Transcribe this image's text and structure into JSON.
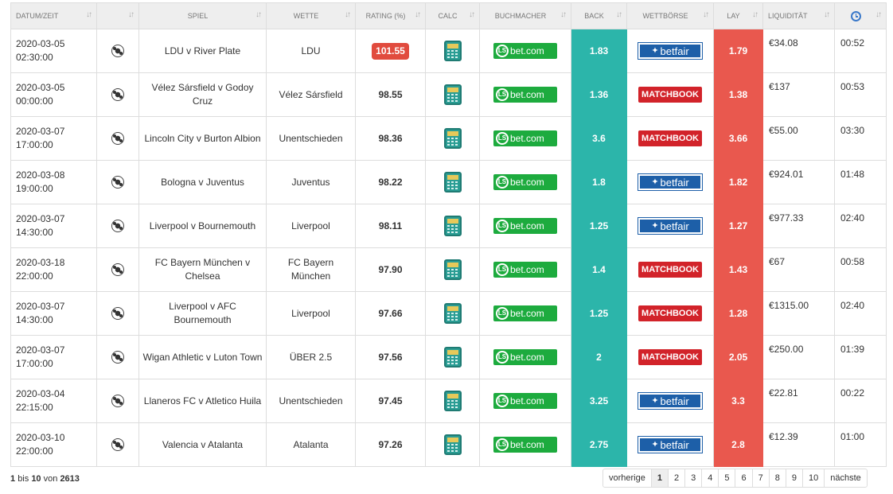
{
  "header": [
    "Datum/Zeit",
    "",
    "Spiel",
    "Wette",
    "Rating (%)",
    "Calc",
    "Buchmacher",
    "Back",
    "Wettbörse",
    "Lay",
    "Liquidität",
    ""
  ],
  "sort_icon": "sort-arrows-icon",
  "rows": [
    {
      "date": "2020-03-05",
      "time": "02:30:00",
      "match": "LDU v River Plate",
      "bet": "LDU",
      "rating": "101.55",
      "hot": true,
      "back": "1.83",
      "exchange": "betfair",
      "lay": "1.79",
      "liquidity": "€34.08",
      "remaining": "00:52"
    },
    {
      "date": "2020-03-05",
      "time": "00:00:00",
      "match": "Vélez Sársfield v Godoy Cruz",
      "bet": "Vélez Sársfield",
      "rating": "98.55",
      "hot": false,
      "back": "1.36",
      "exchange": "matchbook",
      "lay": "1.38",
      "liquidity": "€137",
      "remaining": "00:53"
    },
    {
      "date": "2020-03-07",
      "time": "17:00:00",
      "match": "Lincoln City v Burton Albion",
      "bet": "Unentschieden",
      "rating": "98.36",
      "hot": false,
      "back": "3.6",
      "exchange": "matchbook",
      "lay": "3.66",
      "liquidity": "€55.00",
      "remaining": "03:30"
    },
    {
      "date": "2020-03-08",
      "time": "19:00:00",
      "match": "Bologna v Juventus",
      "bet": "Juventus",
      "rating": "98.22",
      "hot": false,
      "back": "1.8",
      "exchange": "betfair",
      "lay": "1.82",
      "liquidity": "€924.01",
      "remaining": "01:48"
    },
    {
      "date": "2020-03-07",
      "time": "14:30:00",
      "match": "Liverpool v Bournemouth",
      "bet": "Liverpool",
      "rating": "98.11",
      "hot": false,
      "back": "1.25",
      "exchange": "betfair",
      "lay": "1.27",
      "liquidity": "€977.33",
      "remaining": "02:40"
    },
    {
      "date": "2020-03-18",
      "time": "22:00:00",
      "match": "FC Bayern München v Chelsea",
      "bet": "FC Bayern München",
      "rating": "97.90",
      "hot": false,
      "back": "1.4",
      "exchange": "matchbook",
      "lay": "1.43",
      "liquidity": "€67",
      "remaining": "00:58"
    },
    {
      "date": "2020-03-07",
      "time": "14:30:00",
      "match": "Liverpool v AFC Bournemouth",
      "bet": "Liverpool",
      "rating": "97.66",
      "hot": false,
      "back": "1.25",
      "exchange": "matchbook",
      "lay": "1.28",
      "liquidity": "€1315.00",
      "remaining": "02:40"
    },
    {
      "date": "2020-03-07",
      "time": "17:00:00",
      "match": "Wigan Athletic v Luton Town",
      "bet": "ÜBER 2.5",
      "rating": "97.56",
      "hot": false,
      "back": "2",
      "exchange": "matchbook",
      "lay": "2.05",
      "liquidity": "€250.00",
      "remaining": "01:39"
    },
    {
      "date": "2020-03-04",
      "time": "22:15:00",
      "match": "Llaneros FC v Atletico Huila",
      "bet": "Unentschieden",
      "rating": "97.45",
      "hot": false,
      "back": "3.25",
      "exchange": "betfair",
      "lay": "3.3",
      "liquidity": "€22.81",
      "remaining": "00:22"
    },
    {
      "date": "2020-03-10",
      "time": "22:00:00",
      "match": "Valencia v Atalanta",
      "bet": "Atalanta",
      "rating": "97.26",
      "hot": false,
      "back": "2.75",
      "exchange": "betfair",
      "lay": "2.8",
      "liquidity": "€12.39",
      "remaining": "01:00"
    }
  ],
  "bookmaker": {
    "name": "bet.com",
    "badge": "LS"
  },
  "exchanges": {
    "betfair": "betfair",
    "matchbook": "MATCHBOOK"
  },
  "footer": {
    "from": "1",
    "to": "10",
    "total": "2613",
    "bis": "bis",
    "von": "von"
  },
  "pagination": {
    "prev": "vorherige",
    "pages": [
      "1",
      "2",
      "3",
      "4",
      "5",
      "6",
      "7",
      "8",
      "9",
      "10"
    ],
    "active": "1",
    "next": "nächste"
  },
  "colors": {
    "back": "#2cb5aa",
    "lay": "#e9584e",
    "hot_rating": "#e14b3e",
    "bookmaker": "#1dab3e",
    "betfair": "#1d5fa8",
    "matchbook": "#d2232a"
  }
}
